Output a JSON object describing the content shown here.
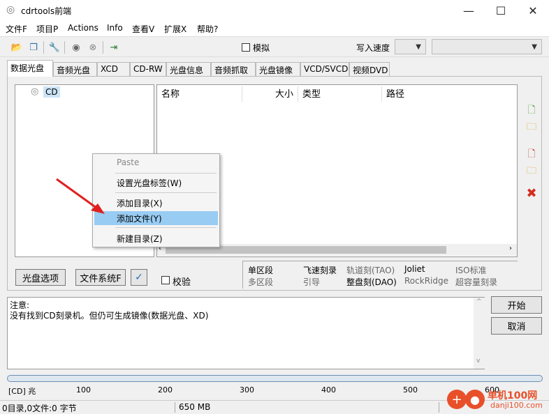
{
  "window": {
    "title": "cdrtools前端",
    "minimize": "—",
    "maximize": "☐",
    "close": "✕"
  },
  "menu": [
    "文件F",
    "项目P",
    "Actions",
    "Info",
    "查看V",
    "扩展X",
    "帮助?"
  ],
  "toolbar": {
    "simulate_label": "模拟",
    "write_speed_label": "写入速度"
  },
  "tabs": [
    "数据光盘",
    "音频光盘",
    "XCD",
    "CD-RW",
    "光盘信息",
    "音频抓取",
    "光盘镜像",
    "VCD/SVCD",
    "视频DVD"
  ],
  "tree": {
    "root": "CD"
  },
  "filelist": {
    "columns": [
      "名称",
      "大小",
      "类型",
      "路径"
    ]
  },
  "context_menu": {
    "items": [
      "Paste",
      "设置光盘标签(W)",
      "添加目录(X)",
      "添加文件(Y)",
      "新建目录(Z)"
    ],
    "highlighted_index": 3
  },
  "buttons": {
    "disc_options": "光盘选项",
    "filesystem": "文件系统F",
    "verify": "校验",
    "start": "开始",
    "cancel": "取消"
  },
  "options": {
    "row1": [
      "单区段",
      "飞速刻录",
      "轨道刻(TAO)",
      "Joliet",
      "ISO标准"
    ],
    "row2": [
      "多区段",
      "引导",
      "整盘刻(DAO)",
      "RockRidge",
      "超容量刻录"
    ]
  },
  "notes": {
    "heading": "注意:",
    "message": "没有找到CD刻录机。但仍可生成镜像(数据光盘、XD)"
  },
  "ruler": {
    "start": "[CD] 兆",
    "ticks": [
      "100",
      "200",
      "300",
      "400",
      "500",
      "600"
    ]
  },
  "status": {
    "left": "0目录,0文件:0 字节",
    "capacity": "650 MB"
  },
  "watermark": {
    "brand": "单机100网",
    "url": "danji100.com"
  }
}
